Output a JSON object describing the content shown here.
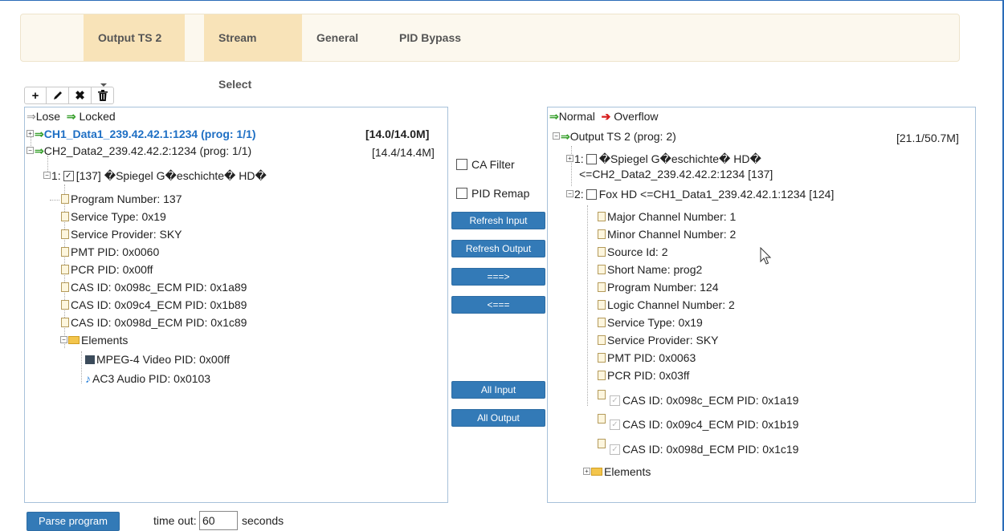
{
  "nav": {
    "output_ts": "Output TS 2",
    "stream_select": "Stream Select",
    "general": "General",
    "pid_bypass": "PID Bypass"
  },
  "toolbar": {
    "add": "+",
    "delete": "✖"
  },
  "left_panel": {
    "legend_lose": "Lose",
    "legend_locked": "Locked",
    "channels": [
      {
        "name": "CH1_Data1_239.42.42.1:1234 (prog: 1/1)",
        "rate": "[14.0/14.0M]"
      },
      {
        "name": "CH2_Data2_239.42.42.2:1234 (prog: 1/1)",
        "rate": "[14.4/14.4M]"
      }
    ],
    "program_prefix": "1:",
    "program_label": "[137] �Spiegel G�eschichte� HD�",
    "items": [
      "Program Number: 137",
      "Service Type: 0x19",
      "Service Provider: SKY",
      "PMT PID: 0x0060",
      "PCR PID: 0x00ff",
      "CAS ID: 0x098c_ECM PID: 0x1a89",
      "CAS ID: 0x09c4_ECM PID: 0x1b89",
      "CAS ID: 0x098d_ECM PID: 0x1c89"
    ],
    "elements_label": "Elements",
    "elements": [
      "MPEG-4 Video PID: 0x00ff",
      "AC3 Audio PID: 0x0103"
    ]
  },
  "middle": {
    "ca_filter": "CA Filter",
    "pid_remap": "PID Remap",
    "refresh_input": "Refresh Input",
    "refresh_output": "Refresh Output",
    "add_arrow": "===>",
    "remove_arrow": "<===",
    "all_input": "All Input",
    "all_output": "All Output"
  },
  "right_panel": {
    "legend_normal": "Normal",
    "legend_overflow": "Overflow",
    "output_name": "Output TS 2 (prog: 2)",
    "output_rate": "[21.1/50.7M]",
    "prog1_prefix": "1:",
    "prog1_line1": "�Spiegel G�eschichte� HD�",
    "prog1_line2": "<=CH2_Data2_239.42.42.2:1234 [137]",
    "prog2_prefix": "2:",
    "prog2_label": "Fox HD <=CH1_Data1_239.42.42.1:1234 [124]",
    "items": [
      "Major Channel Number: 1",
      "Minor Channel Number: 2",
      "Source Id: 2",
      "Short Name: prog2",
      "Program Number: 124",
      "Logic Channel Number: 2",
      "Service Type: 0x19",
      "Service Provider: SKY",
      "PMT PID: 0x0063",
      "PCR PID: 0x03ff"
    ],
    "cas_items": [
      "CAS ID: 0x098c_ECM PID: 0x1a19",
      "CAS ID: 0x09c4_ECM PID: 0x1b19",
      "CAS ID: 0x098d_ECM PID: 0x1c19"
    ],
    "elements_label": "Elements"
  },
  "bottom": {
    "parse_program": "Parse program",
    "timeout_label": "time out:",
    "timeout_value": "60",
    "seconds_label": "seconds"
  },
  "colors": {
    "accent": "#337ab7",
    "nav_active": "#f8e3b8",
    "locked_arrow": "#3aa12f",
    "overflow_arrow": "#d71e1e",
    "channel_highlight": "#1e6fc4"
  }
}
